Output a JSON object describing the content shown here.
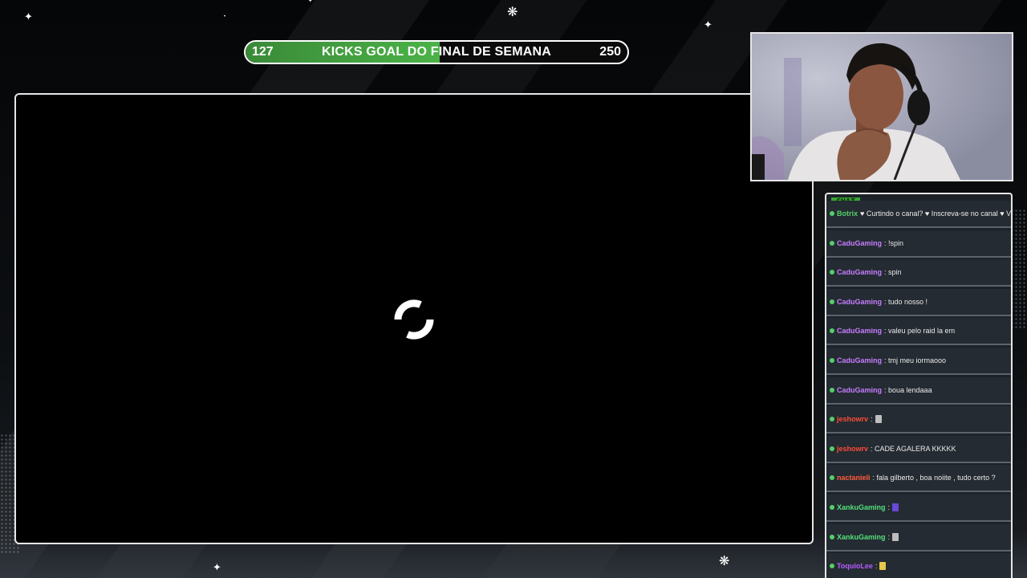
{
  "goal": {
    "current": "127",
    "title": "KICKS GOAL DO FINAL DE SEMANA",
    "target": "250",
    "progress_fraction": 0.508,
    "fill_color": "#4bb347"
  },
  "loading": {
    "icon": "loading-spinner-icon"
  },
  "chat": {
    "tab_label": "CHAT",
    "messages": [
      {
        "user": "Botrix",
        "text": "♥ Curtindo o canal? ♥ Inscreva-se no canal ♥ Você ajuda demais a crescer e",
        "user_color": "#53d069"
      },
      {
        "user": "CaduGaming",
        "text": ": !spin",
        "user_color": "#c77dff"
      },
      {
        "user": "CaduGaming",
        "text": ": spin",
        "user_color": "#c77dff"
      },
      {
        "user": "CaduGaming",
        "text": ": tudo nosso !",
        "user_color": "#c77dff"
      },
      {
        "user": "CaduGaming",
        "text": ": valeu pelo raid la em",
        "user_color": "#c77dff"
      },
      {
        "user": "CaduGaming",
        "text": ": tmj meu iormaooo",
        "user_color": "#c77dff"
      },
      {
        "user": "CaduGaming",
        "text": ": boua lendaaa",
        "user_color": "#c77dff"
      },
      {
        "user": "jeshowrv",
        "text": ":",
        "user_color": "#ff4b3a"
      },
      {
        "user": "jeshowrv",
        "text": ": CADE AGALERA KKKKK",
        "user_color": "#ff4b3a"
      },
      {
        "user": "nactanieli",
        "text": ": fala gilberto , boa noiite , tudo certo ?",
        "user_color": "#ff5a3c"
      },
      {
        "user": "XankuGaming",
        "text": ":",
        "user_color": "#53e07a"
      },
      {
        "user": "XankuGaming",
        "text": ":",
        "user_color": "#53e07a"
      },
      {
        "user": "ToquioLee",
        "text": ":",
        "user_color": "#b85cff"
      }
    ]
  }
}
